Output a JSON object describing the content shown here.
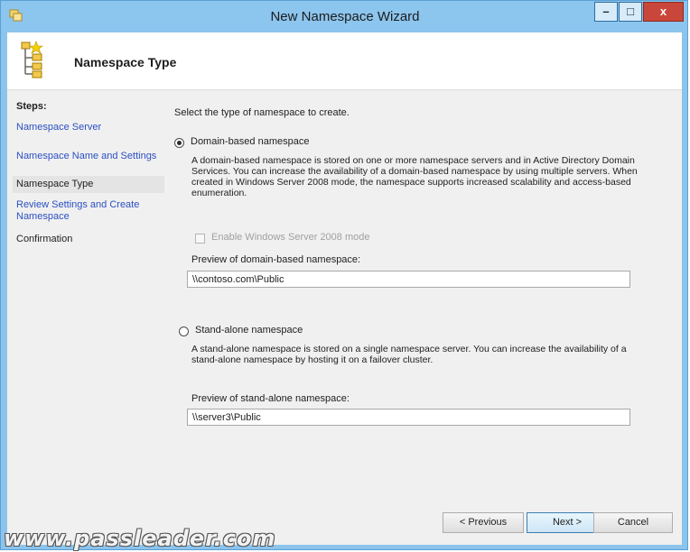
{
  "window": {
    "title": "New Namespace Wizard",
    "minimize_glyph": "–",
    "maximize_glyph": "□",
    "close_glyph": "x"
  },
  "header": {
    "title": "Namespace Type"
  },
  "steps": {
    "label": "Steps:",
    "items": [
      {
        "label": "Namespace Server"
      },
      {
        "label": "Namespace Name and Settings"
      },
      {
        "label": "Namespace Type"
      },
      {
        "label": "Review Settings and Create\nNamespace"
      },
      {
        "label": "Confirmation"
      }
    ]
  },
  "main": {
    "intro": "Select the type of namespace to create.",
    "domain_option": {
      "label": "Domain-based namespace",
      "selected": true,
      "description": "A domain-based namespace is stored on one or more namespace servers and in Active Directory Domain Services. You can increase the availability of a domain-based namespace by using multiple servers. When created in Windows Server 2008 mode, the namespace supports increased scalability and access-based enumeration.",
      "checkbox_label": "Enable Windows Server 2008 mode",
      "checkbox_checked": false,
      "preview_label": "Preview of domain-based namespace:",
      "preview_value": "\\\\contoso.com\\Public"
    },
    "standalone_option": {
      "label": "Stand-alone namespace",
      "selected": false,
      "description": "A stand-alone namespace is stored on a single namespace server. You can increase the availability of a stand-alone namespace by hosting it on a failover cluster.",
      "preview_label": "Preview of stand-alone namespace:",
      "preview_value": "\\\\server3\\Public"
    }
  },
  "buttons": {
    "previous": "< Previous",
    "next": "Next >",
    "cancel": "Cancel"
  },
  "watermark": "www.passleader.com"
}
